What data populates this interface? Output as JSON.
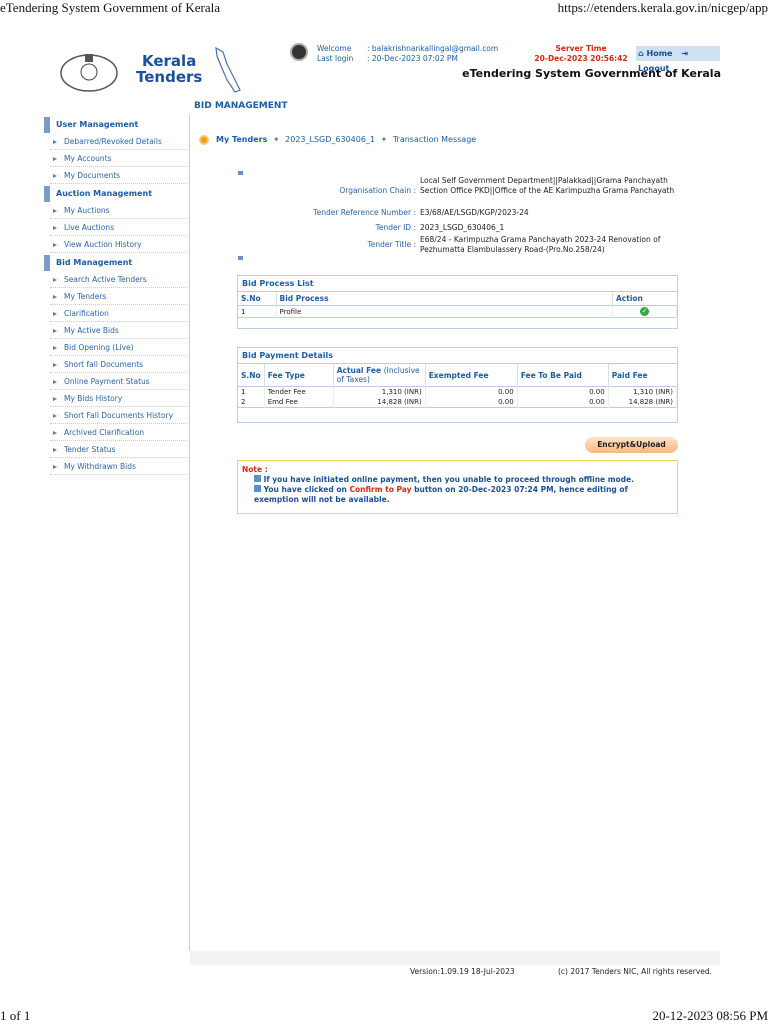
{
  "print": {
    "title": "eTendering System Government of Kerala",
    "url": "https://etenders.kerala.gov.in/nicgep/app",
    "page": "1 of 1",
    "datetime": "20-12-2023 08:56 PM"
  },
  "header": {
    "logo_line1": "Kerala",
    "logo_line2": "Tenders",
    "welcome_label": "Welcome",
    "welcome_value": ": balakrishnankallingal@gmail.com",
    "lastlogin_label": "Last login",
    "lastlogin_value": ": 20-Dec-2023 07:02 PM",
    "server_time_label": "Server Time",
    "server_time": "20-Dec-2023 20:56:42",
    "home": "Home",
    "logout": "Logout",
    "system_title": "eTendering System Government of Kerala",
    "section": "BID MANAGEMENT"
  },
  "sidebar": [
    {
      "heading": "User Management",
      "items": [
        "Debarred/Revoked Details",
        "My Accounts",
        "My Documents"
      ]
    },
    {
      "heading": "Auction Management",
      "items": [
        "My Auctions",
        "Live Auctions",
        "View Auction History"
      ]
    },
    {
      "heading": "Bid Management",
      "items": [
        "Search Active Tenders",
        "My Tenders",
        "Clarification",
        "My Active Bids",
        "Bid Opening (Live)",
        "Short fall Documents",
        "Online Payment Status",
        "My Bids History",
        "Short Fall Documents History",
        "Archived Clarification",
        "Tender Status",
        "My Withdrawn Bids"
      ]
    }
  ],
  "breadcrumb": [
    "My Tenders",
    "2023_LSGD_630406_1",
    "Transaction Message"
  ],
  "details": {
    "org_label": "Organisation Chain :",
    "org_value": "Local Self Government Department||Palakkad||Grama Panchayath Section Office PKD||Office of the AE Karimpuzha Grama Panchayath",
    "ref_label": "Tender Reference Number :",
    "ref_value": "E3/68/AE/LSGD/KGP/2023-24",
    "id_label": "Tender ID :",
    "id_value": "2023_LSGD_630406_1",
    "title_label": "Tender Title :",
    "title_value": "E68/24 - Karimpuzha Grama Panchayath 2023-24 Renovation of Pezhumatta Elambulassery Road-(Pro.No.258/24)"
  },
  "bid_process": {
    "title": "Bid Process List",
    "headers": [
      "S.No",
      "Bid Process",
      "Action"
    ],
    "rows": [
      [
        "1",
        "Profile"
      ]
    ]
  },
  "payment": {
    "title": "Bid Payment Details",
    "headers": [
      "S.No",
      "Fee Type",
      "Actual Fee",
      "(Inclusive of Taxes)",
      "Exempted Fee",
      "Fee To Be Paid",
      "Paid Fee"
    ],
    "rows": [
      [
        "1",
        "Tender Fee",
        "1,310 (INR)",
        "0.00",
        "0.00",
        "1,310 (INR)"
      ],
      [
        "2",
        "Emd Fee",
        "14,828 (INR)",
        "0.00",
        "0.00",
        "14,828 (INR)"
      ]
    ]
  },
  "encrypt_button": "Encrypt&Upload",
  "note": {
    "title": "Note :",
    "line1": "If you have initiated online payment, then you unable to proceed through offline mode.",
    "line2_pre": "You have clicked on ",
    "line2_red": "Confirm to Pay",
    "line2_post": " button on 20-Dec-2023 07:24 PM, hence editing of exemption will not be available."
  },
  "footer": {
    "version": "Version:1.09.19 18-Jul-2023",
    "copyright": "(c) 2017 Tenders NIC, All rights reserved."
  }
}
